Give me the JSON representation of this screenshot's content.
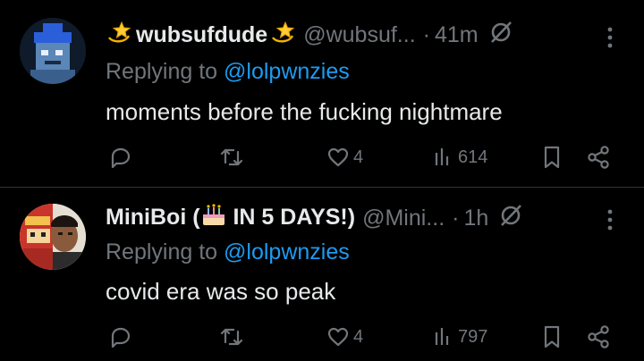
{
  "replies": [
    {
      "display_name": "wubsufdude",
      "name_emoji": "dizzy-star-icon",
      "handle": "@wubsuf...",
      "separator": "·",
      "time": "41m",
      "replying_prefix": "Replying to ",
      "replying_to": "@lolpwnzies",
      "text": "moments before the fucking nightmare",
      "likes": "4",
      "views": "614"
    },
    {
      "display_name_pre": "MiniBoi (",
      "name_emoji": "birthday-cake-icon",
      "display_name_post": " IN 5 DAYS!)",
      "handle": "@Mini...",
      "separator": "·",
      "time": "1h",
      "replying_prefix": "Replying to ",
      "replying_to": "@lolpwnzies",
      "text": "covid era was so peak",
      "likes": "4",
      "views": "797"
    }
  ],
  "colors": {
    "background": "#000000",
    "primary_text": "#e7e9ea",
    "secondary_text": "#71767b",
    "mention": "#1d9bf0",
    "divider": "#2f3336"
  }
}
